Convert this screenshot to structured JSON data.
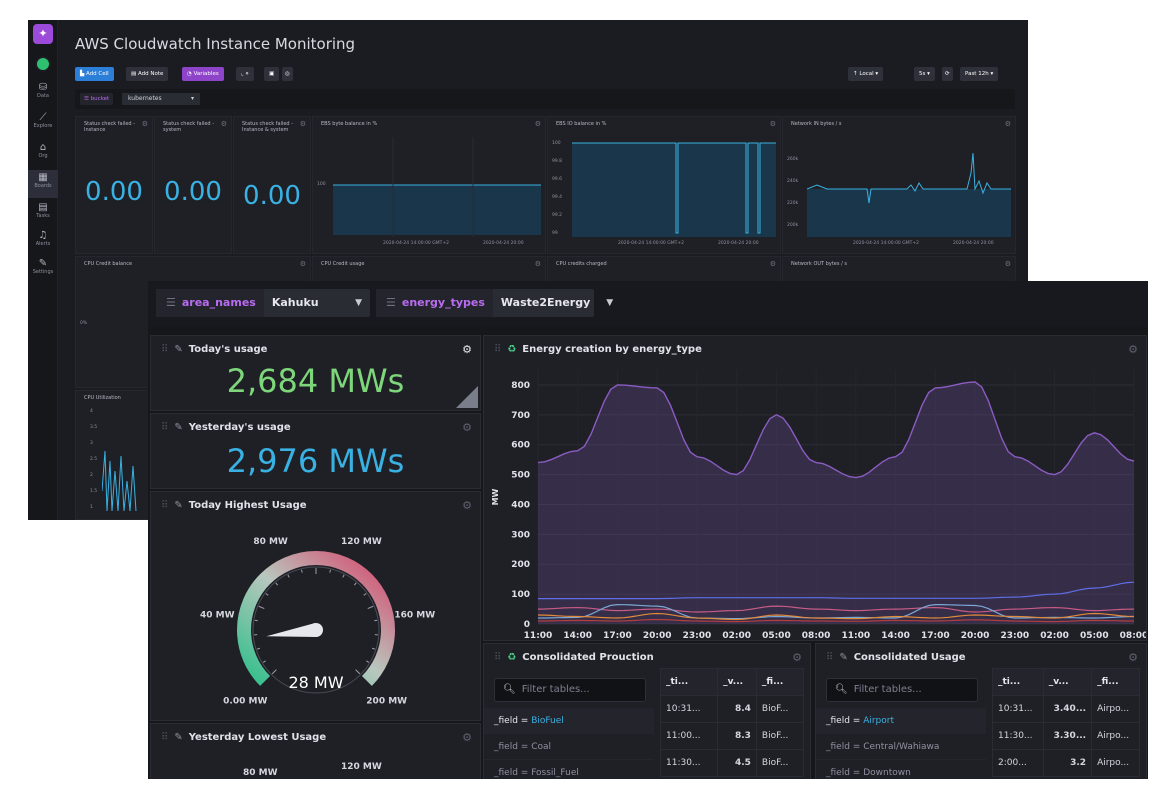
{
  "back": {
    "title": "AWS Cloudwatch Instance Monitoring",
    "rail": [
      {
        "label": "Data",
        "icon": "database-icon",
        "glyph": "⛁"
      },
      {
        "label": "Explore",
        "icon": "explore-icon",
        "glyph": "⟋"
      },
      {
        "label": "Org",
        "icon": "org-icon",
        "glyph": "⌂"
      },
      {
        "label": "Boards",
        "icon": "dashboards-icon",
        "glyph": "▦"
      },
      {
        "label": "Tasks",
        "icon": "tasks-icon",
        "glyph": "▤"
      },
      {
        "label": "Alerts",
        "icon": "bell-icon",
        "glyph": "♫"
      },
      {
        "label": "Settings",
        "icon": "wrench-icon",
        "glyph": "✎"
      }
    ],
    "toolbar": {
      "add_cell": "Add Cell",
      "add_note": "Add Note",
      "variables": "Variables",
      "timezone": "Local",
      "refresh": "5s",
      "range": "Past 12h"
    },
    "var": {
      "key": "bucket",
      "value": "kubernetes"
    },
    "stats": [
      {
        "caption": "Status check failed - Instance",
        "value": "0.00"
      },
      {
        "caption": "Status check failed - system",
        "value": "0.00"
      },
      {
        "caption": "Status check failed - Instance & system",
        "value": "0.00"
      }
    ],
    "graphs": [
      {
        "caption": "EBS byte balance in %",
        "t1": "2020-04-24 14:00:00 GMT+2",
        "t2": "2020-04-24 20:00",
        "y": [
          "100"
        ]
      },
      {
        "caption": "EBS IO balance in %",
        "t1": "2020-04-24 14:00:00 GMT+2",
        "t2": "2020-04-24 20:00",
        "y": [
          "100",
          "99.8",
          "99.6",
          "99.4",
          "99.2",
          "99"
        ]
      },
      {
        "caption": "Network IN bytes / s",
        "t1": "2020-04-24 14:00:00 GMT+2",
        "t2": "2020-04-24 20:00",
        "y": [
          "260k",
          "240k",
          "220k",
          "200k",
          "180k"
        ]
      }
    ],
    "row2": [
      "CPU Credit balance",
      "CPU Credit usage",
      "CPU credits charged",
      "Network OUT bytes / s"
    ],
    "cpu": {
      "caption": "CPU Utilization",
      "y": [
        "4",
        "3.5",
        "3",
        "2.5",
        "2",
        "1.5",
        "1"
      ]
    },
    "left_tick": "0%"
  },
  "front": {
    "vars": [
      {
        "key": "area_names",
        "value": "Kahuku"
      },
      {
        "key": "energy_types",
        "value": "Waste2Energy"
      }
    ],
    "today": {
      "title": "Today's usage",
      "value": "2,684 MWs",
      "color": "#7ed67a"
    },
    "yesterday": {
      "title": "Yesterday's usage",
      "value": "2,976 MWs",
      "color": "#3ab1e3"
    },
    "gauge": {
      "title": "Today Highest Usage",
      "value": 28,
      "min": 0,
      "max": 200,
      "readout": "28 MW",
      "labels": [
        "0.00 MW",
        "40 MW",
        "80 MW",
        "120 MW",
        "160 MW",
        "200 MW"
      ]
    },
    "lowest": {
      "title": "Yesterday Lowest Usage",
      "labels": [
        "80 MW",
        "120 MW"
      ]
    },
    "chart": {
      "title": "Energy creation by energy_type",
      "ylabel": "MW",
      "yticks": [
        "0",
        "100",
        "200",
        "300",
        "400",
        "500",
        "600",
        "700",
        "800"
      ],
      "xticks": [
        "11:00",
        "14:00",
        "17:00",
        "20:00",
        "23:00",
        "02:00",
        "05:00",
        "08:00",
        "11:00",
        "14:00",
        "17:00",
        "20:00",
        "23:00",
        "02:00",
        "05:00",
        "08:00"
      ]
    },
    "production": {
      "title": "Consolidated Prouction",
      "filter": "Filter tables...",
      "fields": [
        {
          "prefix": "_field = ",
          "name": "BioFuel",
          "selected": true
        },
        {
          "prefix": "_field = ",
          "name": "Coal",
          "selected": false
        },
        {
          "prefix": "_field = ",
          "name": "Fossil_Fuel",
          "selected": false
        }
      ],
      "columns": [
        "_ti...",
        "_v...",
        "_fi..."
      ],
      "rows": [
        [
          "10:31...",
          "8.4",
          "BioF..."
        ],
        [
          "11:00...",
          "8.3",
          "BioF..."
        ],
        [
          "11:30...",
          "4.5",
          "BioF..."
        ]
      ]
    },
    "usage": {
      "title": "Consolidated Usage",
      "filter": "Filter tables...",
      "fields": [
        {
          "prefix": "_field = ",
          "name": "Airport",
          "selected": true
        },
        {
          "prefix": "_field = ",
          "name": "Central/Wahiawa",
          "selected": false
        },
        {
          "prefix": "_field = ",
          "name": "Downtown",
          "selected": false
        }
      ],
      "columns": [
        "_ti...",
        "_v...",
        "_fi..."
      ],
      "rows": [
        [
          "10:31...",
          "3.40...",
          "Airpo..."
        ],
        [
          "11:30...",
          "3.30...",
          "Airpo..."
        ],
        [
          "2:00...",
          "3.2",
          "Airpo..."
        ]
      ]
    }
  },
  "chart_data": {
    "type": "line",
    "title": "Energy creation by energy_type",
    "xlabel": "",
    "ylabel": "MW",
    "ylim": [
      0,
      850
    ],
    "x": [
      "11:00",
      "14:00",
      "17:00",
      "20:00",
      "23:00",
      "02:00",
      "05:00",
      "08:00",
      "11:00",
      "14:00",
      "17:00",
      "20:00",
      "23:00",
      "02:00",
      "05:00",
      "08:00"
    ],
    "series": [
      {
        "color": "#8a5cc2",
        "values": [
          540,
          580,
          800,
          790,
          560,
          500,
          700,
          540,
          490,
          560,
          790,
          810,
          560,
          500,
          640,
          545
        ]
      },
      {
        "color": "#5e6ee6",
        "values": [
          85,
          85,
          85,
          85,
          88,
          88,
          88,
          88,
          86,
          86,
          86,
          86,
          90,
          100,
          120,
          140
        ]
      },
      {
        "color": "#c85c86",
        "values": [
          50,
          55,
          45,
          50,
          40,
          45,
          60,
          50,
          45,
          50,
          55,
          40,
          50,
          55,
          45,
          50
        ]
      },
      {
        "color": "#7aa7d6",
        "values": [
          20,
          22,
          65,
          60,
          20,
          18,
          25,
          20,
          22,
          20,
          65,
          62,
          20,
          22,
          20,
          25
        ]
      },
      {
        "color": "#e08a3a",
        "values": [
          30,
          25,
          20,
          35,
          20,
          15,
          30,
          20,
          18,
          25,
          20,
          30,
          25,
          20,
          35,
          25
        ]
      },
      {
        "color": "#b03f3f",
        "values": [
          10,
          12,
          10,
          15,
          10,
          8,
          12,
          10,
          9,
          12,
          10,
          14,
          10,
          8,
          12,
          10
        ]
      }
    ]
  }
}
